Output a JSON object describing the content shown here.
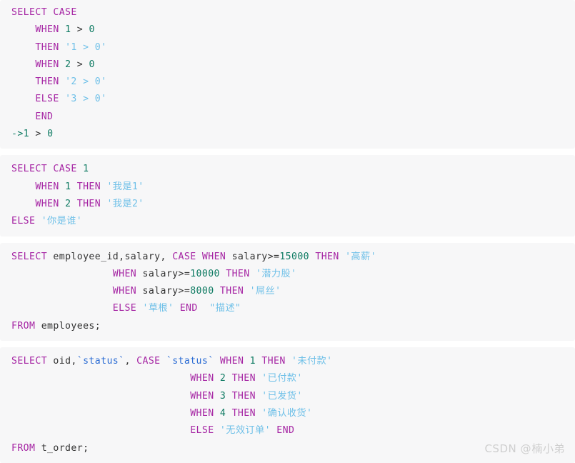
{
  "page": {
    "background_color": "#ffffff",
    "block_background_color": "#f7f7f8"
  },
  "syntax_colors": {
    "keyword": "#a626a4",
    "string": "#6fc0e8",
    "number": "#0f7b63",
    "identifier": "#333333",
    "backtick_identifier": "#2b6cd4"
  },
  "blocks": [
    {
      "id": "block-1",
      "lines": [
        [
          {
            "t": "SELECT CASE",
            "c": "kw"
          }
        ],
        [
          {
            "t": "    ",
            "c": "op"
          },
          {
            "t": "WHEN",
            "c": "kw"
          },
          {
            "t": " ",
            "c": "op"
          },
          {
            "t": "1",
            "c": "num"
          },
          {
            "t": " > ",
            "c": "op"
          },
          {
            "t": "0",
            "c": "num"
          }
        ],
        [
          {
            "t": "    ",
            "c": "op"
          },
          {
            "t": "THEN",
            "c": "kw"
          },
          {
            "t": " ",
            "c": "op"
          },
          {
            "t": "'1 > 0'",
            "c": "str"
          }
        ],
        [
          {
            "t": "    ",
            "c": "op"
          },
          {
            "t": "WHEN",
            "c": "kw"
          },
          {
            "t": " ",
            "c": "op"
          },
          {
            "t": "2",
            "c": "num"
          },
          {
            "t": " > ",
            "c": "op"
          },
          {
            "t": "0",
            "c": "num"
          }
        ],
        [
          {
            "t": "    ",
            "c": "op"
          },
          {
            "t": "THEN",
            "c": "kw"
          },
          {
            "t": " ",
            "c": "op"
          },
          {
            "t": "'2 > 0'",
            "c": "str"
          }
        ],
        [
          {
            "t": "    ",
            "c": "op"
          },
          {
            "t": "ELSE",
            "c": "kw"
          },
          {
            "t": " ",
            "c": "op"
          },
          {
            "t": "'3 > 0'",
            "c": "str"
          }
        ],
        [
          {
            "t": "    ",
            "c": "op"
          },
          {
            "t": "END",
            "c": "kw"
          }
        ],
        [
          {
            "t": "->",
            "c": "arrow"
          },
          {
            "t": "1",
            "c": "num"
          },
          {
            "t": " > ",
            "c": "op"
          },
          {
            "t": "0",
            "c": "num"
          }
        ]
      ]
    },
    {
      "id": "block-2",
      "lines": [
        [
          {
            "t": "SELECT CASE",
            "c": "kw"
          },
          {
            "t": " ",
            "c": "op"
          },
          {
            "t": "1",
            "c": "num"
          }
        ],
        [
          {
            "t": "    ",
            "c": "op"
          },
          {
            "t": "WHEN",
            "c": "kw"
          },
          {
            "t": " ",
            "c": "op"
          },
          {
            "t": "1",
            "c": "num"
          },
          {
            "t": " ",
            "c": "op"
          },
          {
            "t": "THEN",
            "c": "kw"
          },
          {
            "t": " ",
            "c": "op"
          },
          {
            "t": "'我是1'",
            "c": "str"
          }
        ],
        [
          {
            "t": "    ",
            "c": "op"
          },
          {
            "t": "WHEN",
            "c": "kw"
          },
          {
            "t": " ",
            "c": "op"
          },
          {
            "t": "2",
            "c": "num"
          },
          {
            "t": " ",
            "c": "op"
          },
          {
            "t": "THEN",
            "c": "kw"
          },
          {
            "t": " ",
            "c": "op"
          },
          {
            "t": "'我是2'",
            "c": "str"
          }
        ],
        [
          {
            "t": "ELSE",
            "c": "kw"
          },
          {
            "t": " ",
            "c": "op"
          },
          {
            "t": "'你是谁'",
            "c": "str"
          }
        ]
      ]
    },
    {
      "id": "block-3",
      "lines": [
        [
          {
            "t": "SELECT",
            "c": "kw"
          },
          {
            "t": " employee_id,salary, ",
            "c": "id"
          },
          {
            "t": "CASE WHEN",
            "c": "kw"
          },
          {
            "t": " salary>=",
            "c": "id"
          },
          {
            "t": "15000",
            "c": "num"
          },
          {
            "t": " ",
            "c": "op"
          },
          {
            "t": "THEN",
            "c": "kw"
          },
          {
            "t": " ",
            "c": "op"
          },
          {
            "t": "'高薪'",
            "c": "str"
          }
        ],
        [
          {
            "t": "                 ",
            "c": "op"
          },
          {
            "t": "WHEN",
            "c": "kw"
          },
          {
            "t": " salary>=",
            "c": "id"
          },
          {
            "t": "10000",
            "c": "num"
          },
          {
            "t": " ",
            "c": "op"
          },
          {
            "t": "THEN",
            "c": "kw"
          },
          {
            "t": " ",
            "c": "op"
          },
          {
            "t": "'潜力股'",
            "c": "str"
          }
        ],
        [
          {
            "t": "                 ",
            "c": "op"
          },
          {
            "t": "WHEN",
            "c": "kw"
          },
          {
            "t": " salary>=",
            "c": "id"
          },
          {
            "t": "8000",
            "c": "num"
          },
          {
            "t": " ",
            "c": "op"
          },
          {
            "t": "THEN",
            "c": "kw"
          },
          {
            "t": " ",
            "c": "op"
          },
          {
            "t": "'屌丝'",
            "c": "str"
          }
        ],
        [
          {
            "t": "                 ",
            "c": "op"
          },
          {
            "t": "ELSE",
            "c": "kw"
          },
          {
            "t": " ",
            "c": "op"
          },
          {
            "t": "'草根'",
            "c": "str"
          },
          {
            "t": " ",
            "c": "op"
          },
          {
            "t": "END",
            "c": "kw"
          },
          {
            "t": "  ",
            "c": "op"
          },
          {
            "t": "\"描述\"",
            "c": "str"
          }
        ],
        [
          {
            "t": "FROM",
            "c": "kw"
          },
          {
            "t": " employees;",
            "c": "id"
          }
        ]
      ]
    },
    {
      "id": "block-4",
      "lines": [
        [
          {
            "t": "SELECT",
            "c": "kw"
          },
          {
            "t": " oid,",
            "c": "id"
          },
          {
            "t": "`status`",
            "c": "tick"
          },
          {
            "t": ", ",
            "c": "id"
          },
          {
            "t": "CASE",
            "c": "kw"
          },
          {
            "t": " ",
            "c": "op"
          },
          {
            "t": "`status`",
            "c": "tick"
          },
          {
            "t": " ",
            "c": "op"
          },
          {
            "t": "WHEN",
            "c": "kw"
          },
          {
            "t": " ",
            "c": "op"
          },
          {
            "t": "1",
            "c": "num"
          },
          {
            "t": " ",
            "c": "op"
          },
          {
            "t": "THEN",
            "c": "kw"
          },
          {
            "t": " ",
            "c": "op"
          },
          {
            "t": "'未付款'",
            "c": "str"
          }
        ],
        [
          {
            "t": "                              ",
            "c": "op"
          },
          {
            "t": "WHEN",
            "c": "kw"
          },
          {
            "t": " ",
            "c": "op"
          },
          {
            "t": "2",
            "c": "num"
          },
          {
            "t": " ",
            "c": "op"
          },
          {
            "t": "THEN",
            "c": "kw"
          },
          {
            "t": " ",
            "c": "op"
          },
          {
            "t": "'已付款'",
            "c": "str"
          }
        ],
        [
          {
            "t": "                              ",
            "c": "op"
          },
          {
            "t": "WHEN",
            "c": "kw"
          },
          {
            "t": " ",
            "c": "op"
          },
          {
            "t": "3",
            "c": "num"
          },
          {
            "t": " ",
            "c": "op"
          },
          {
            "t": "THEN",
            "c": "kw"
          },
          {
            "t": " ",
            "c": "op"
          },
          {
            "t": "'已发货'",
            "c": "str"
          }
        ],
        [
          {
            "t": "                              ",
            "c": "op"
          },
          {
            "t": "WHEN",
            "c": "kw"
          },
          {
            "t": " ",
            "c": "op"
          },
          {
            "t": "4",
            "c": "num"
          },
          {
            "t": " ",
            "c": "op"
          },
          {
            "t": "THEN",
            "c": "kw"
          },
          {
            "t": " ",
            "c": "op"
          },
          {
            "t": "'确认收货'",
            "c": "str"
          }
        ],
        [
          {
            "t": "                              ",
            "c": "op"
          },
          {
            "t": "ELSE",
            "c": "kw"
          },
          {
            "t": " ",
            "c": "op"
          },
          {
            "t": "'无效订单'",
            "c": "str"
          },
          {
            "t": " ",
            "c": "op"
          },
          {
            "t": "END",
            "c": "kw"
          }
        ],
        [
          {
            "t": "FROM",
            "c": "kw"
          },
          {
            "t": " t_order;",
            "c": "id"
          }
        ]
      ]
    }
  ],
  "watermark": {
    "text": "CSDN @\u0001楠小弟"
  }
}
